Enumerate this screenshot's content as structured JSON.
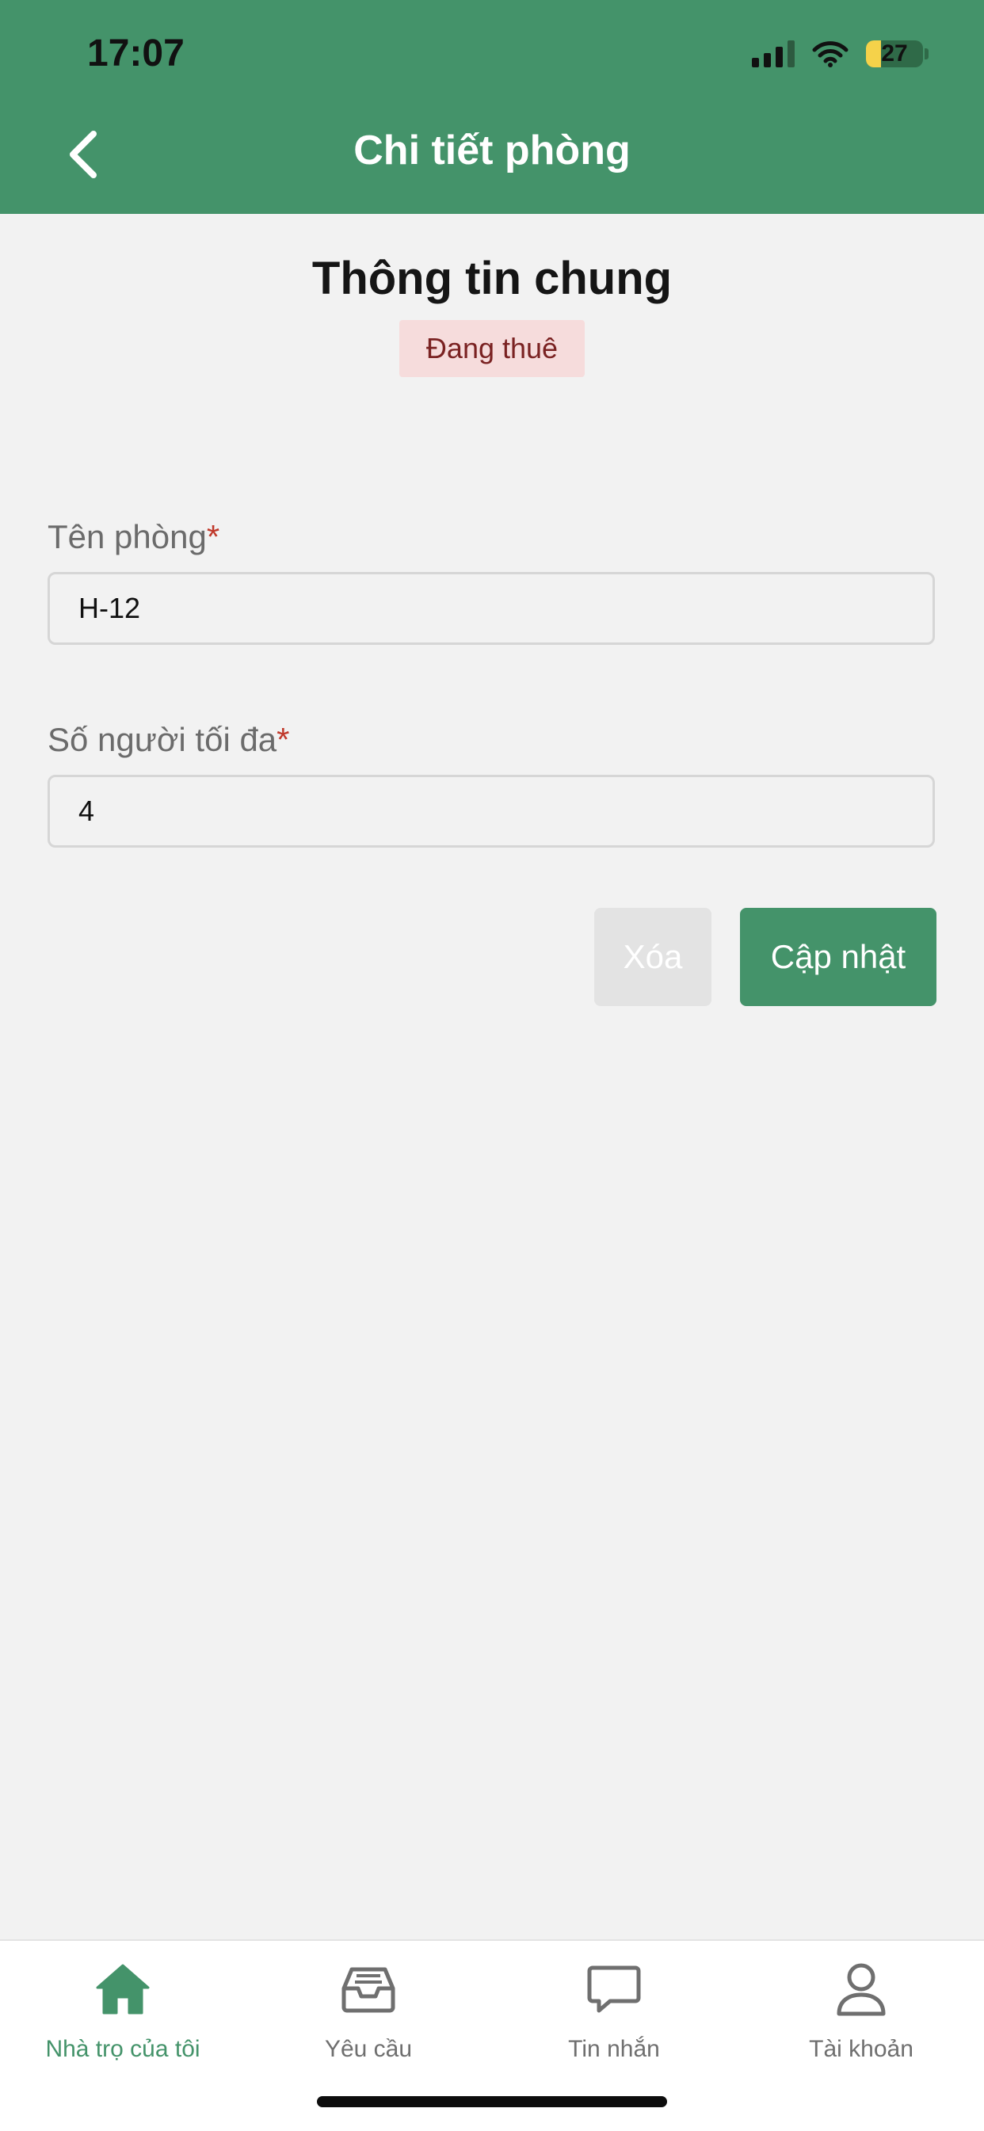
{
  "status_bar": {
    "time": "17:07",
    "battery": "27",
    "battery_level": 0.27
  },
  "header": {
    "title": "Chi tiết phòng",
    "back_icon": "chevron-left-icon"
  },
  "section": {
    "title": "Thông tin chung",
    "status_badge": "Đang thuê"
  },
  "form": {
    "room_name": {
      "label": "Tên phòng",
      "required_mark": "*",
      "value": "H-12"
    },
    "max_people": {
      "label": "Số người tối đa",
      "required_mark": "*",
      "value": "4"
    }
  },
  "actions": {
    "delete_label": "Xóa",
    "update_label": "Cập nhật"
  },
  "tabs": [
    {
      "label": "Nhà trọ của tôi",
      "icon": "home-icon",
      "active": true
    },
    {
      "label": "Yêu cầu",
      "icon": "inbox-icon",
      "active": false
    },
    {
      "label": "Tin nhắn",
      "icon": "chat-bubble-icon",
      "active": false
    },
    {
      "label": "Tài khoản",
      "icon": "user-icon",
      "active": false
    }
  ],
  "colors": {
    "primary": "#44936a",
    "badge_bg": "#f6dcdc",
    "badge_text": "#7a2222",
    "required": "#c0392b",
    "background": "#f2f2f2"
  }
}
